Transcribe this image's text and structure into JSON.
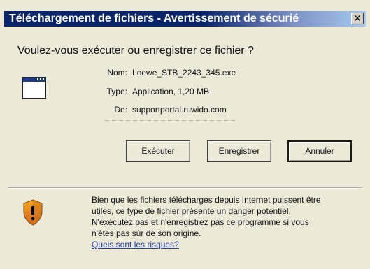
{
  "dialog": {
    "title": "Téléchargement de fichiers - Avertissement de sécurié",
    "close_glyph": "✕",
    "question": "Voulez-vous exécuter ou enregistrer ce fichier ?",
    "file_icon": "application-window-icon",
    "info": {
      "name_label": "Nom:",
      "name_value": "Loewe_STB_2243_345.exe",
      "type_label": "Type:",
      "type_value": "Application, 1,20 MB",
      "from_label": "De:",
      "from_value": "supportportal.ruwido.com"
    },
    "buttons": {
      "run": "Exécuter",
      "save": "Enregistrer",
      "cancel": "Annuler"
    },
    "warning": {
      "icon": "security-shield-icon",
      "text": "Bien que les fichiers télécharges depuis Internet puissent être utiles, ce type de fichier présente un danger potentiel. N'exécutez pas et n'enregistrez pas ce programme si vous n'êtes pas sûr de son origine.",
      "link": "Quels sont les risques?",
      "colors": {
        "shield_top": "#f5a623",
        "shield_bottom": "#d2691e",
        "mark": "#000000"
      }
    }
  }
}
